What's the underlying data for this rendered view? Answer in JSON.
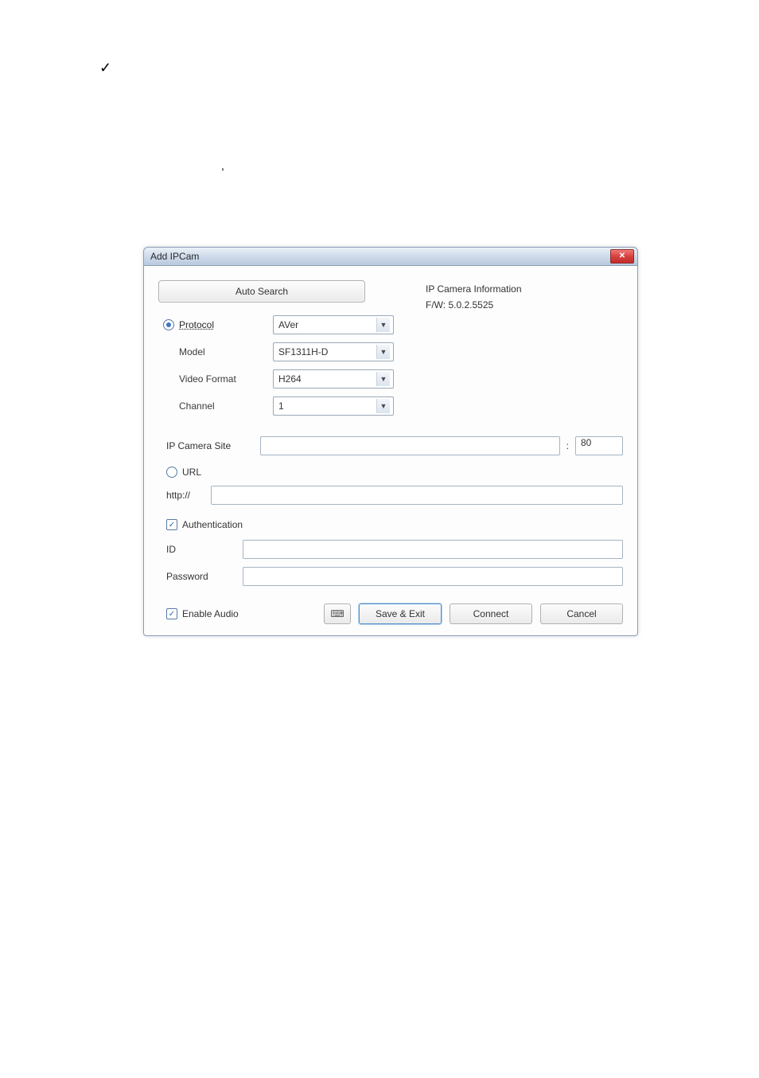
{
  "decor": {
    "check": "✓",
    "comma": ","
  },
  "dialog": {
    "title": "Add IPCam",
    "close_x": "✕",
    "auto_search": "Auto Search",
    "protocol_label": "Protocol",
    "model_label": "Model",
    "video_format_label": "Video Format",
    "channel_label": "Channel",
    "protocol_value": "AVer",
    "model_value": "SF1311H-D",
    "video_format_value": "H264",
    "channel_value": "1",
    "info_title": "IP Camera Information",
    "info_fw": "F/W: 5.0.2.5525",
    "ip_camera_site_label": "IP Camera Site",
    "colon": ":",
    "port": "80",
    "url_label": "URL",
    "http_prefix": "http://",
    "authentication_label": "Authentication",
    "id_label": "ID",
    "password_label": "Password",
    "enable_audio_label": "Enable Audio",
    "keyboard_icon": "⌨",
    "save_exit": "Save & Exit",
    "connect": "Connect",
    "cancel": "Cancel"
  }
}
